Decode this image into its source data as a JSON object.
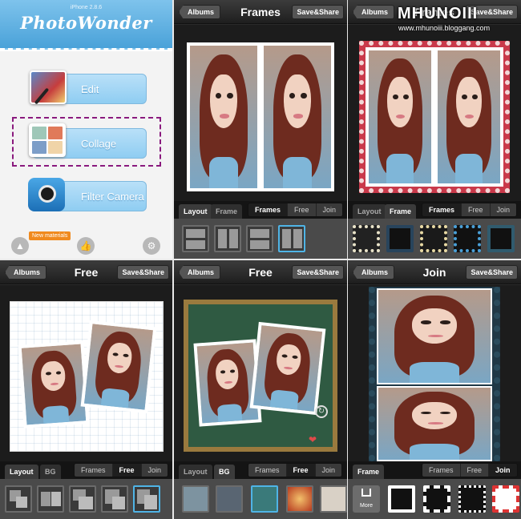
{
  "home": {
    "version": "iPhone 2.8.6",
    "logo": "PhotoWonder",
    "buttons": [
      "Edit",
      "Collage",
      "Filter Camera"
    ],
    "new_badge": "New materials"
  },
  "panels": [
    {
      "left": "Albums",
      "title": "Frames",
      "right": "Save&Share",
      "tabs": [
        "Layout",
        "Frame"
      ],
      "active_tab": "Layout",
      "modes": [
        "Frames",
        "Free",
        "Join"
      ],
      "active_mode": "Frames"
    },
    {
      "left": "Albums",
      "title": "Frames",
      "right": "Save&Share",
      "tabs": [
        "Layout",
        "Frame"
      ],
      "active_tab": "Frame",
      "modes": [
        "Frames",
        "Free",
        "Join"
      ],
      "active_mode": "Frames"
    },
    {
      "left": "Albums",
      "title": "Free",
      "right": "Save&Share",
      "tabs": [
        "Layout",
        "BG"
      ],
      "active_tab": "Layout",
      "modes": [
        "Frames",
        "Free",
        "Join"
      ],
      "active_mode": "Free"
    },
    {
      "left": "Albums",
      "title": "Free",
      "right": "Save&Share",
      "tabs": [
        "Layout",
        "BG"
      ],
      "active_tab": "BG",
      "modes": [
        "Frames",
        "Free",
        "Join"
      ],
      "active_mode": "Free"
    },
    {
      "left": "Albums",
      "title": "Join",
      "right": "Save&Share",
      "tabs": [
        "Frame"
      ],
      "active_tab": "Frame",
      "modes": [
        "Frames",
        "Free",
        "Join"
      ],
      "active_mode": "Join",
      "more_label": "More"
    }
  ],
  "watermark": {
    "brand": "MHUNOIII",
    "blog": "www.mhunoiii.bloggang.com"
  },
  "colors": {
    "accent_blue": "#4fb4e6",
    "highlight_purple": "#8a1a7e",
    "badge_orange": "#f08a1e"
  },
  "icons": [
    "photo-edit-icon",
    "collage-icon",
    "camera-icon",
    "materials-icon",
    "thumbs-up-icon",
    "gear-icon",
    "download-icon"
  ]
}
